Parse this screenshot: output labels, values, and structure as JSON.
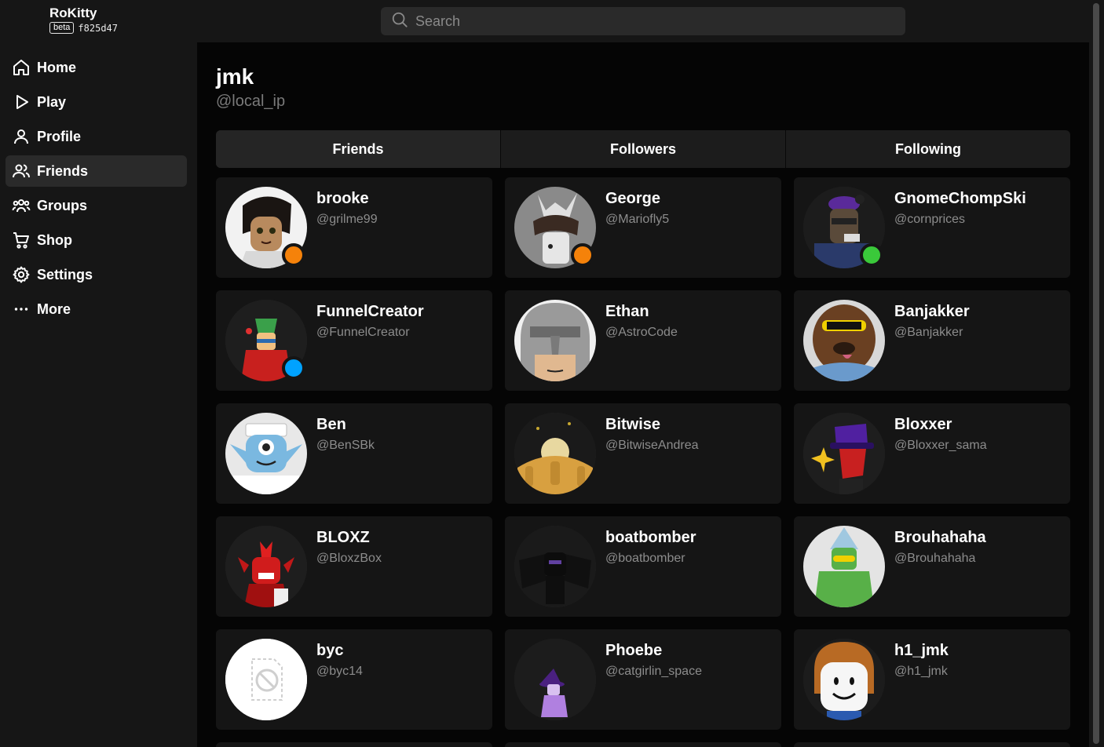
{
  "app": {
    "name": "RoKitty",
    "badge": "beta",
    "commit": "f825d47"
  },
  "search": {
    "placeholder": "Search"
  },
  "sidebar": {
    "items": [
      {
        "label": "Home",
        "icon": "home-icon"
      },
      {
        "label": "Play",
        "icon": "play-icon"
      },
      {
        "label": "Profile",
        "icon": "user-icon"
      },
      {
        "label": "Friends",
        "icon": "users-icon",
        "active": true
      },
      {
        "label": "Groups",
        "icon": "group-icon"
      },
      {
        "label": "Shop",
        "icon": "cart-icon"
      },
      {
        "label": "Settings",
        "icon": "gear-icon"
      },
      {
        "label": "More",
        "icon": "ellipsis-icon"
      }
    ]
  },
  "profile": {
    "display_name": "jmk",
    "username": "@local_ip"
  },
  "tabs": [
    {
      "label": "Friends",
      "active": true
    },
    {
      "label": "Followers"
    },
    {
      "label": "Following"
    }
  ],
  "friends": [
    {
      "name": "brooke",
      "username": "@grilme99",
      "status": "orange"
    },
    {
      "name": "George",
      "username": "@Mariofly5",
      "status": "orange"
    },
    {
      "name": "GnomeChompSki",
      "username": "@cornprices",
      "status": "green"
    },
    {
      "name": "FunnelCreator",
      "username": "@FunnelCreator",
      "status": "blue"
    },
    {
      "name": "Ethan",
      "username": "@AstroCode"
    },
    {
      "name": "Banjakker",
      "username": "@Banjakker"
    },
    {
      "name": "Ben",
      "username": "@BenSBk"
    },
    {
      "name": "Bitwise",
      "username": "@BitwiseAndrea"
    },
    {
      "name": "Bloxxer",
      "username": "@Bloxxer_sama"
    },
    {
      "name": "BLOXZ",
      "username": "@BloxzBox"
    },
    {
      "name": "boatbomber",
      "username": "@boatbomber"
    },
    {
      "name": "Brouhahaha",
      "username": "@Brouhahaha"
    },
    {
      "name": "byc",
      "username": "@byc14"
    },
    {
      "name": "Phoebe",
      "username": "@catgirlin_space"
    },
    {
      "name": "h1_jmk",
      "username": "@h1_jmk"
    }
  ],
  "colors": {
    "status_orange": "#f5820a",
    "status_green": "#3ac93a",
    "status_blue": "#00a2ff"
  }
}
